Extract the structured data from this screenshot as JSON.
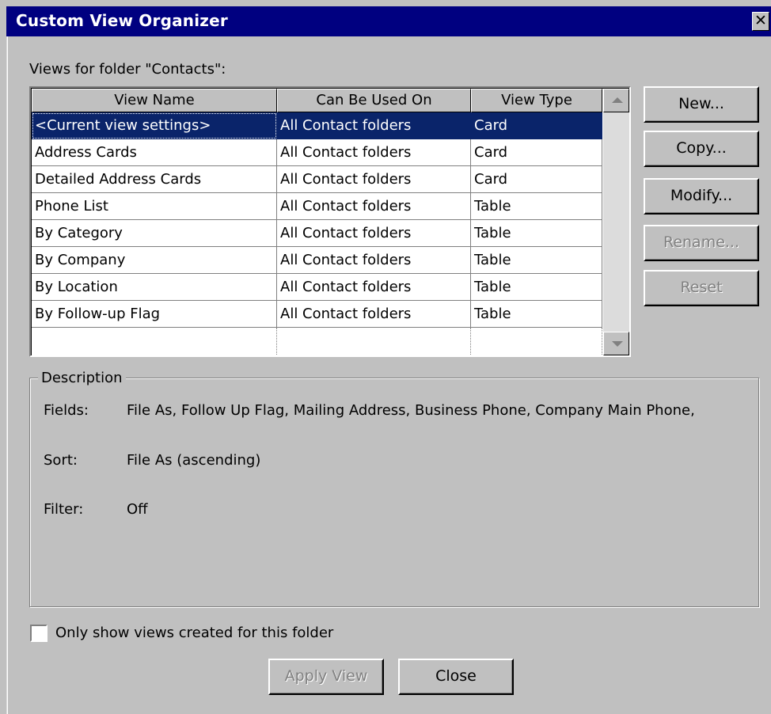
{
  "window": {
    "title": "Custom View Organizer",
    "close_glyph": "✕"
  },
  "views_label": "Views for folder \"Contacts\":",
  "table": {
    "headers": [
      "View Name",
      "Can Be Used On",
      "View Type"
    ],
    "rows": [
      [
        "<Current view settings>",
        "All Contact folders",
        "Card"
      ],
      [
        "Address Cards",
        "All Contact folders",
        "Card"
      ],
      [
        "Detailed Address Cards",
        "All Contact folders",
        "Card"
      ],
      [
        "Phone List",
        "All Contact folders",
        "Table"
      ],
      [
        "By Category",
        "All Contact folders",
        "Table"
      ],
      [
        "By Company",
        "All Contact folders",
        "Table"
      ],
      [
        "By Location",
        "All Contact folders",
        "Table"
      ],
      [
        "By Follow-up Flag",
        "All Contact folders",
        "Table"
      ]
    ],
    "selected_row": 0
  },
  "buttons": {
    "new": "New...",
    "copy": "Copy...",
    "modify": "Modify...",
    "rename": "Rename...",
    "reset": "Reset",
    "apply": "Apply View",
    "close": "Close"
  },
  "description": {
    "title": "Description",
    "fields_label": "Fields:",
    "fields_value": "File As, Follow Up Flag, Mailing Address, Business Phone, Company Main Phone,",
    "sort_label": "Sort:",
    "sort_value": "File As (ascending)",
    "filter_label": "Filter:",
    "filter_value": "Off"
  },
  "only_show_label": "Only show views created for this folder",
  "colors": {
    "titlebar": "#000080",
    "selection": "#0a246a",
    "face": "#c0c0c0"
  }
}
